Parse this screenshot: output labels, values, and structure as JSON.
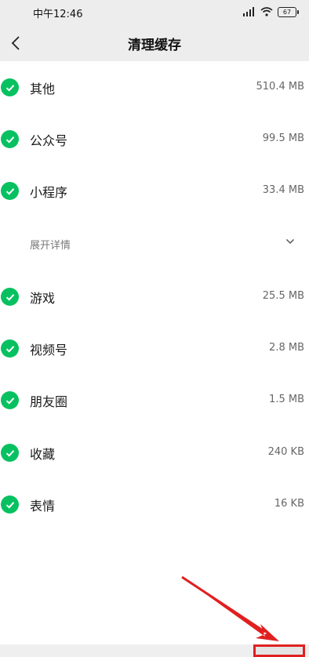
{
  "status_bar": {
    "time": "中午12:46",
    "battery": "67"
  },
  "header": {
    "title": "清理缓存",
    "back_icon": "chevron-left-icon"
  },
  "items_top": [
    {
      "label": "其他",
      "size": "510.4 MB"
    },
    {
      "label": "公众号",
      "size": "99.5 MB"
    },
    {
      "label": "小程序",
      "size": "33.4 MB"
    }
  ],
  "expand": {
    "label": "展开详情",
    "icon": "chevron-down-icon"
  },
  "items_bottom": [
    {
      "label": "游戏",
      "size": "25.5 MB"
    },
    {
      "label": "视频号",
      "size": "2.8 MB"
    },
    {
      "label": "朋友圈",
      "size": "1.5 MB"
    },
    {
      "label": "收藏",
      "size": "240 KB"
    },
    {
      "label": "表情",
      "size": "16 KB"
    }
  ],
  "colors": {
    "accent": "#07c160",
    "annotation": "#e02020"
  }
}
